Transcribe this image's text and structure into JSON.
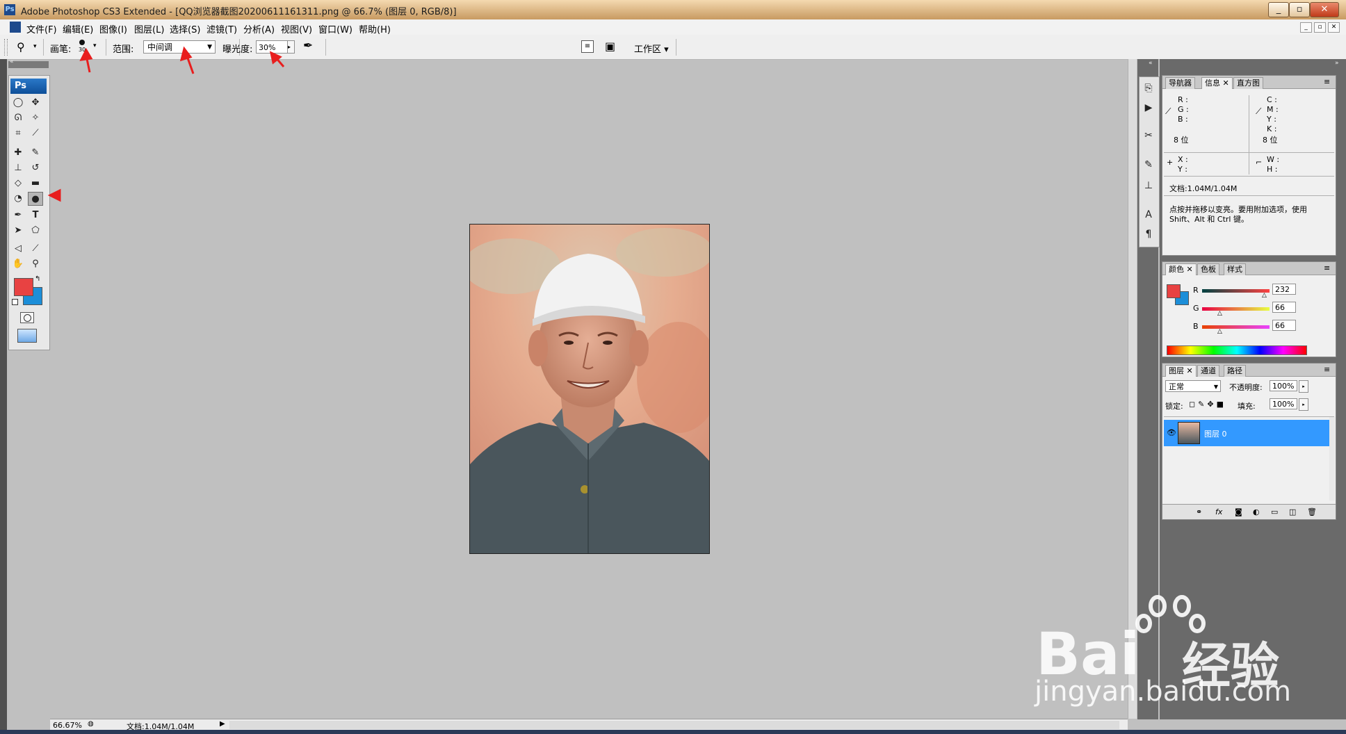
{
  "window": {
    "title": "Adobe Photoshop CS3 Extended - [QQ浏览器截图20200611161311.png @ 66.7% (图层 0, RGB/8)]",
    "app_icon": "Ps",
    "buttons": {
      "minimize": "_",
      "restore": "▫",
      "close": "✕"
    }
  },
  "menu": {
    "items": [
      "文件(F)",
      "编辑(E)",
      "图像(I)",
      "图层(L)",
      "选择(S)",
      "滤镜(T)",
      "分析(A)",
      "视图(V)",
      "窗口(W)",
      "帮助(H)"
    ],
    "mdi_buttons": [
      "_",
      "▫",
      "✕"
    ]
  },
  "options": {
    "brush_label": "画笔:",
    "brush_size": "30",
    "range_label": "范围:",
    "range_value": "中间调",
    "exposure_label": "曝光度:",
    "exposure_value": "30%",
    "workspace_label": "工作区 ▾"
  },
  "toolbox": {
    "logo": "Ps",
    "foreground_color": "#e84242",
    "background_color": "#1c8ed8"
  },
  "status": {
    "zoom": "66.67%",
    "doc": "文档:1.04M/1.04M"
  },
  "info_panel": {
    "tabs": [
      "导航器",
      "信息",
      "直方图"
    ],
    "rgb": [
      "R :",
      "G :",
      "B :"
    ],
    "cmyk": [
      "C :",
      "M :",
      "Y :",
      "K :"
    ],
    "bits_left": "8 位",
    "bits_right": "8 位",
    "xy": [
      "X :",
      "Y :"
    ],
    "wh": [
      "W :",
      "H :"
    ],
    "doc": "文档:1.04M/1.04M",
    "hint_line1": "点按并拖移以变亮。要用附加选项，使用",
    "hint_line2": "Shift、Alt 和 Ctrl 键。"
  },
  "color_panel": {
    "tabs": [
      "颜色",
      "色板",
      "样式"
    ],
    "channels": [
      {
        "label": "R",
        "value": "232"
      },
      {
        "label": "G",
        "value": "66"
      },
      {
        "label": "B",
        "value": "66"
      }
    ]
  },
  "layers_panel": {
    "tabs": [
      "图层",
      "通道",
      "路径"
    ],
    "blend_mode": "正常",
    "opacity_label": "不透明度:",
    "opacity_value": "100%",
    "lock_label": "锁定:",
    "fill_label": "填充:",
    "fill_value": "100%",
    "layer_name": "图层 0"
  },
  "watermark": {
    "brand_latin": "Bai",
    "brand_cn": "经验",
    "url": "jingyan.baidu.com"
  },
  "annotation_color": "#e81e1e"
}
